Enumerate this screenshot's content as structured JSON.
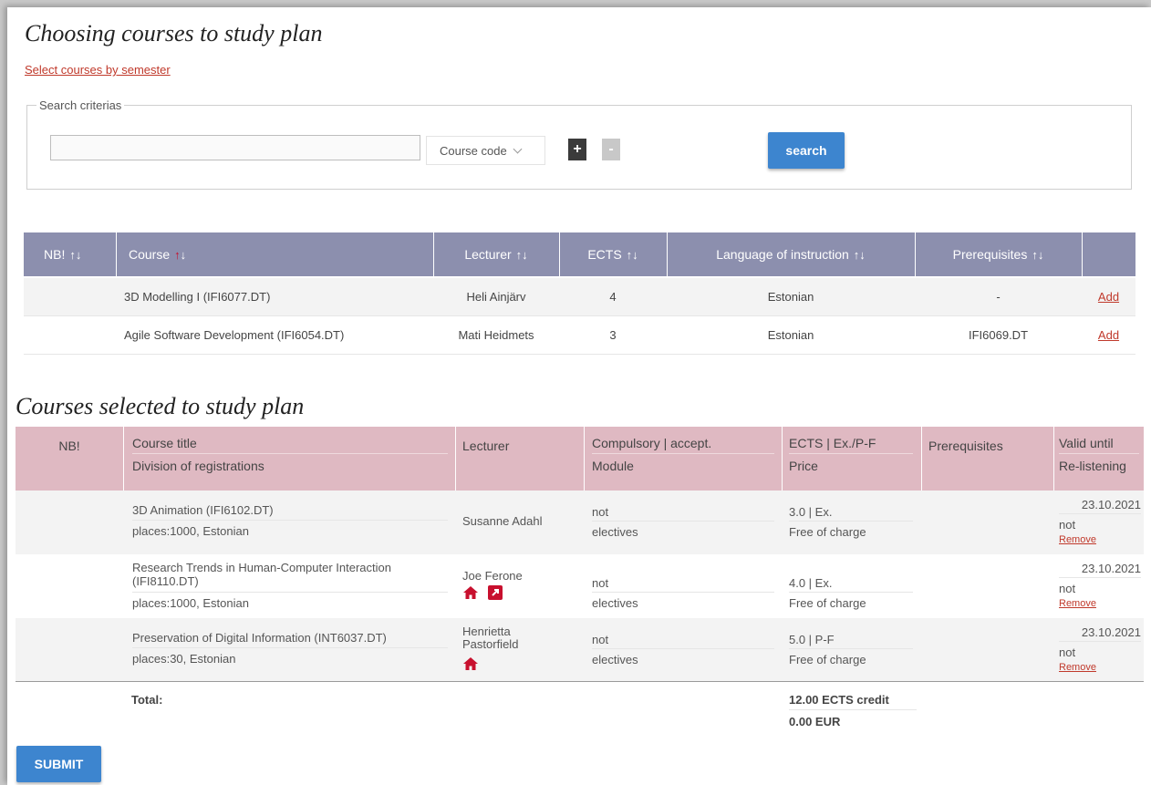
{
  "page": {
    "title": "Choosing courses to study plan",
    "select_by_semester_link": "Select courses by semester"
  },
  "search": {
    "legend": "Search criterias",
    "input_value": "",
    "field_select": "Course code",
    "plus_label": "+",
    "minus_label": "-",
    "search_button": "search"
  },
  "available_table": {
    "headers": {
      "nb": "NB!",
      "course": "Course",
      "lecturer": "Lecturer",
      "ects": "ECTS",
      "language": "Language of instruction",
      "prerequisites": "Prerequisites"
    },
    "sort_arrows": "↑↓",
    "rows": [
      {
        "nb": "",
        "course": "3D Modelling I (IFI6077.DT)",
        "lecturer": "Heli Ainjärv",
        "ects": "4",
        "language": "Estonian",
        "prerequisites": "-",
        "action": "Add"
      },
      {
        "nb": "",
        "course": "Agile Software Development (IFI6054.DT)",
        "lecturer": "Mati Heidmets",
        "ects": "3",
        "language": "Estonian",
        "prerequisites": "IFI6069.DT",
        "action": "Add"
      }
    ]
  },
  "selected_section": {
    "title": "Courses selected to study plan",
    "headers": {
      "nb": "NB!",
      "course_title": "Course title",
      "division": "Division of registrations",
      "lecturer": "Lecturer",
      "compulsory": "Compulsory | accept.",
      "module": "Module",
      "ects_exam": "ECTS | Ex./P-F",
      "price": "Price",
      "prerequisites": "Prerequisites",
      "valid_until": "Valid until",
      "relistening": "Re-listening"
    },
    "rows": [
      {
        "title": "3D Animation (IFI6102.DT)",
        "division": "places:1000, Estonian",
        "lecturer": "Susanne Adahl",
        "compulsory": "not",
        "module": "electives",
        "ects": "3.0 | Ex.",
        "price": "Free of charge",
        "valid_until": "23.10.2021",
        "relisten": "not",
        "remove": "Remove"
      },
      {
        "title": "Research Trends in Human-Computer Interaction (IFI8110.DT)",
        "division": "places:1000, Estonian",
        "lecturer": "Joe Ferone",
        "compulsory": "not",
        "module": "electives",
        "ects": "4.0 | Ex.",
        "price": "Free of charge",
        "valid_until": "23.10.2021",
        "relisten": "not",
        "remove": "Remove"
      },
      {
        "title": "Preservation of Digital Information (INT6037.DT)",
        "division": "places:30, Estonian",
        "lecturer": "Henrietta Pastorfield",
        "compulsory": "not",
        "module": "electives",
        "ects": "5.0 | P-F",
        "price": "Free of charge",
        "valid_until": "23.10.2021",
        "relisten": "not",
        "remove": "Remove"
      }
    ],
    "total_label": "Total:",
    "total_ects": "12.00 ECTS credit",
    "total_price": "0.00 EUR"
  },
  "submit_label": "SUBMIT",
  "colors": {
    "top_header": "#8c8fae",
    "bottom_header": "#dfb9c2",
    "accent_blue": "#3d85cf",
    "link_red": "#c0392b",
    "icon_red": "#c8102e"
  }
}
